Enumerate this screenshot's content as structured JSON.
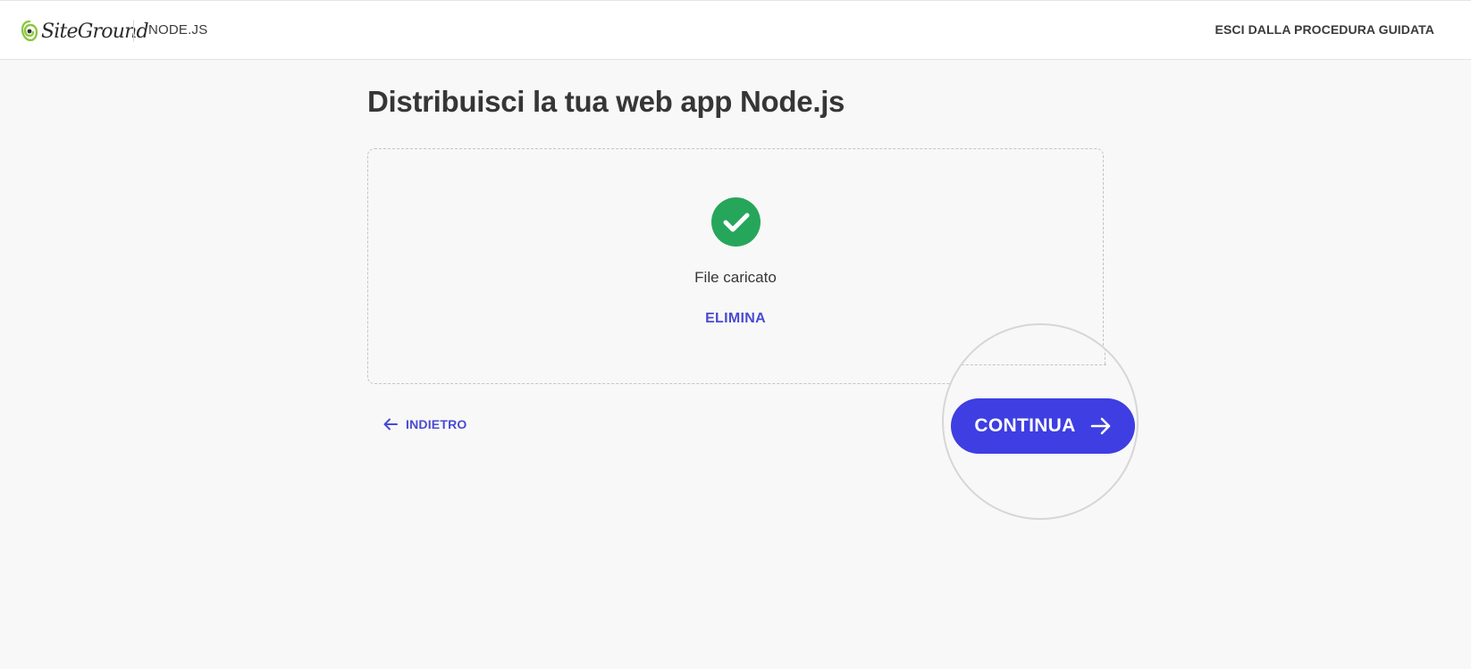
{
  "header": {
    "logo_text": "SiteGround",
    "section": "NODE.JS",
    "exit_label": "ESCI DALLA PROCEDURA GUIDATA"
  },
  "main": {
    "title": "Distribuisci la tua web app Node.js",
    "upload": {
      "status": "File caricato",
      "delete_label": "ELIMINA"
    },
    "back_label": "INDIETRO",
    "continue_label": "CONTINUA"
  },
  "colors": {
    "accent": "#3e3ee2",
    "link": "#4a4ad4",
    "success": "#26a65b",
    "brand_green": "#8cc63f"
  },
  "icons": [
    "siteground-logo-icon",
    "check-circle-icon",
    "arrow-left-icon",
    "arrow-right-icon"
  ]
}
